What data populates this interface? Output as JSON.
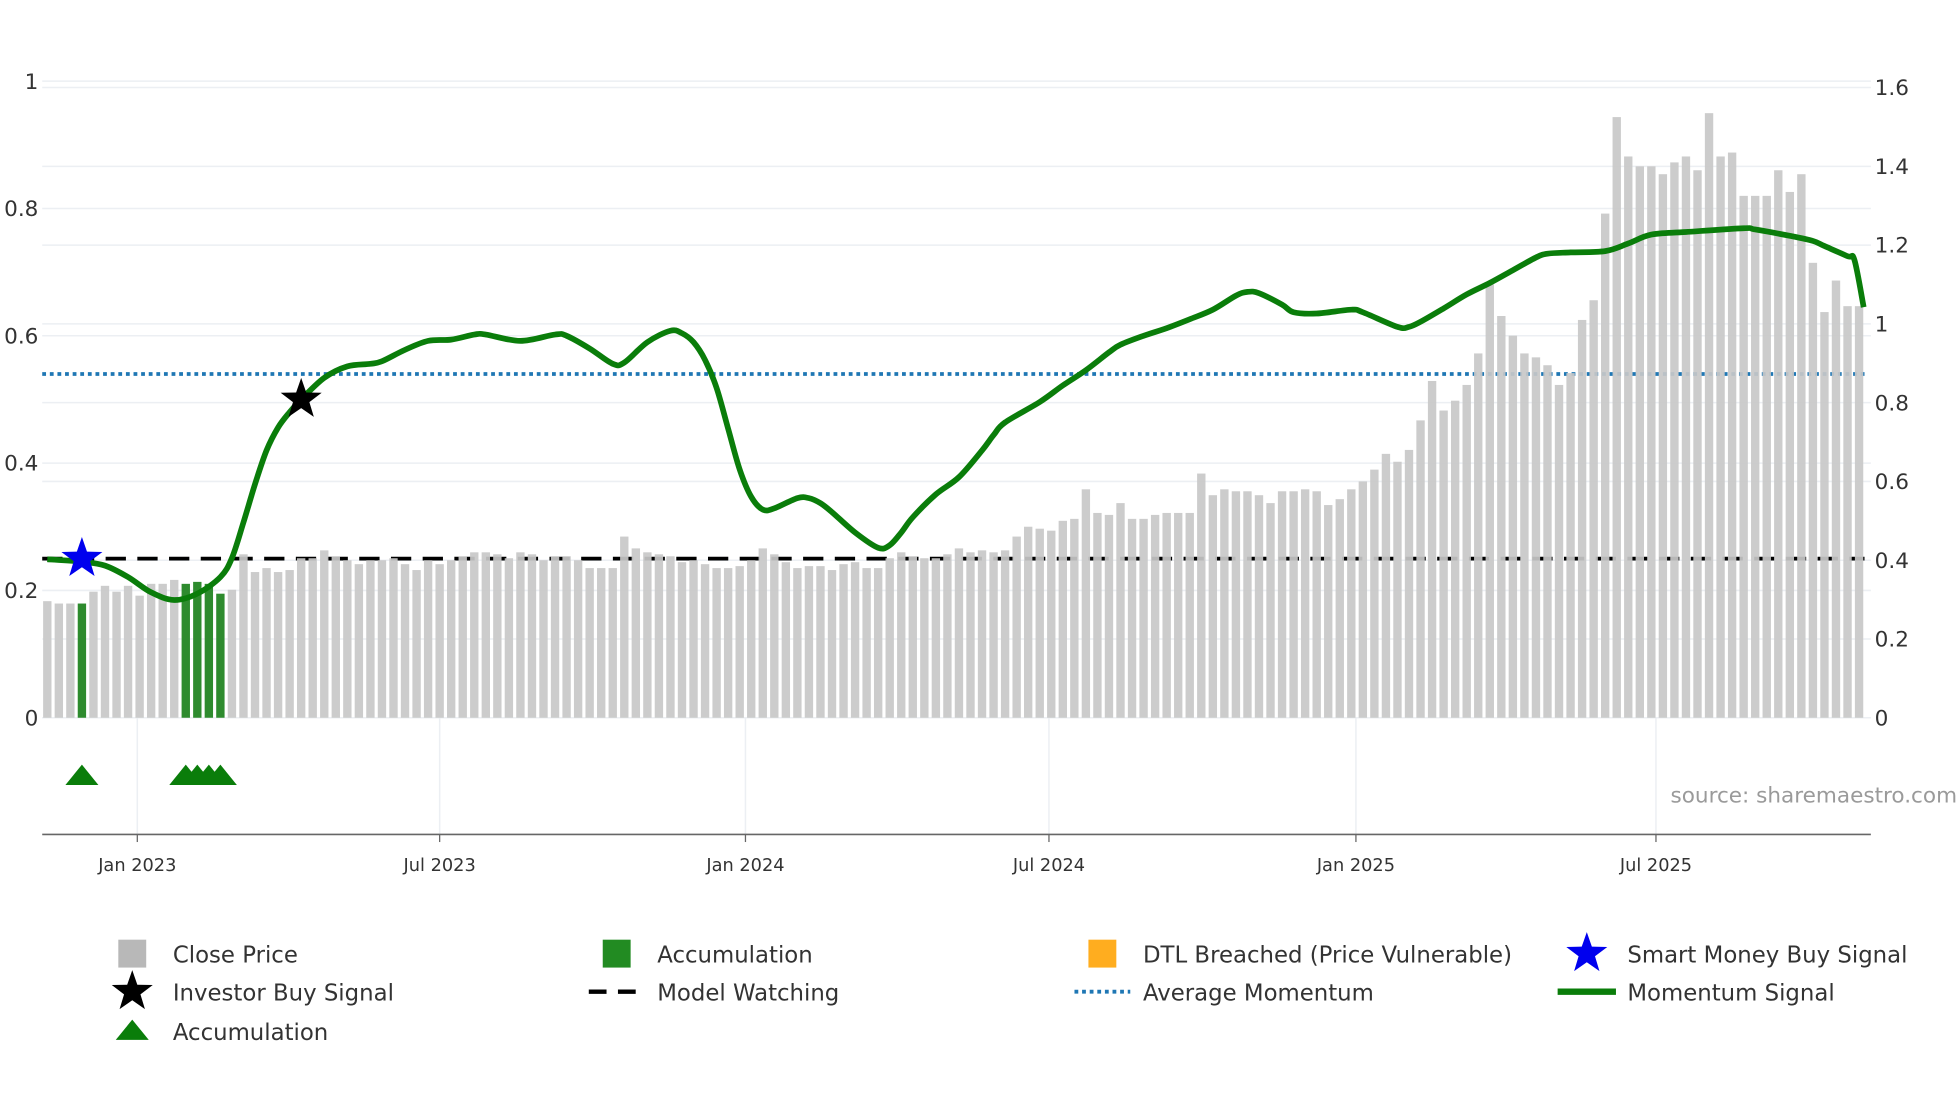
{
  "chart_data": {
    "type": "bar",
    "title": "",
    "source_label": "source: sharemaestro.com",
    "x_unit": "week index",
    "x_ticks": [
      {
        "label": "Jan 2023",
        "x": 7.8
      },
      {
        "label": "Jul 2023",
        "x": 34.0
      },
      {
        "label": "Jan 2024",
        "x": 60.5
      },
      {
        "label": "Jul 2024",
        "x": 86.8
      },
      {
        "label": "Jan 2025",
        "x": 113.4
      },
      {
        "label": "Jul 2025",
        "x": 139.4
      }
    ],
    "y_left": {
      "ticks": [
        "0",
        "0.2",
        "0.4",
        "0.6",
        "0.8",
        "1"
      ],
      "tick_values": [
        0,
        0.2,
        0.4,
        0.6,
        0.8,
        1
      ],
      "range": [
        -0.183,
        1.04
      ]
    },
    "y_right": {
      "ticks": [
        "0",
        "0.2",
        "0.4",
        "0.6",
        "0.8",
        "1",
        "1.2",
        "1.4",
        "1.6"
      ],
      "tick_values": [
        0,
        0.2,
        0.4,
        0.6,
        0.8,
        1,
        1.2,
        1.4,
        1.6
      ]
    },
    "close_price": [
      0.296,
      0.29,
      0.29,
      0.29,
      0.32,
      0.335,
      0.32,
      0.335,
      0.31,
      0.34,
      0.34,
      0.35,
      0.34,
      0.345,
      0.34,
      0.315,
      0.325,
      0.415,
      0.37,
      0.38,
      0.37,
      0.375,
      0.405,
      0.405,
      0.425,
      0.41,
      0.4,
      0.39,
      0.4,
      0.4,
      0.405,
      0.39,
      0.375,
      0.4,
      0.39,
      0.4,
      0.41,
      0.42,
      0.42,
      0.415,
      0.405,
      0.42,
      0.415,
      0.4,
      0.41,
      0.41,
      0.4,
      0.38,
      0.38,
      0.38,
      0.46,
      0.43,
      0.42,
      0.415,
      0.41,
      0.395,
      0.4,
      0.39,
      0.38,
      0.38,
      0.385,
      0.4,
      0.43,
      0.415,
      0.395,
      0.38,
      0.385,
      0.385,
      0.375,
      0.39,
      0.395,
      0.38,
      0.38,
      0.405,
      0.42,
      0.41,
      0.405,
      0.405,
      0.415,
      0.43,
      0.42,
      0.425,
      0.42,
      0.425,
      0.46,
      0.485,
      0.48,
      0.475,
      0.5,
      0.505,
      0.58,
      0.52,
      0.515,
      0.545,
      0.505,
      0.505,
      0.515,
      0.52,
      0.52,
      0.52,
      0.62,
      0.565,
      0.58,
      0.575,
      0.575,
      0.565,
      0.545,
      0.575,
      0.575,
      0.58,
      0.575,
      0.54,
      0.555,
      0.58,
      0.6,
      0.63,
      0.67,
      0.65,
      0.68,
      0.755,
      0.855,
      0.78,
      0.805,
      0.845,
      0.925,
      1.1,
      1.02,
      0.97,
      0.925,
      0.915,
      0.895,
      0.845,
      0.875,
      1.01,
      1.06,
      1.28,
      1.525,
      1.425,
      1.4,
      1.4,
      1.38,
      1.41,
      1.425,
      1.39,
      1.535,
      1.425,
      1.435,
      1.325,
      1.325,
      1.325,
      1.39,
      1.335,
      1.38,
      1.155,
      1.03,
      1.11,
      1.045,
      1.045
    ],
    "accumulation_weeks": [
      3,
      12,
      13,
      14,
      15
    ],
    "momentum_signal": [
      [
        0,
        0.249
      ],
      [
        3,
        0.245
      ],
      [
        5,
        0.239
      ],
      [
        7,
        0.221
      ],
      [
        9,
        0.197
      ],
      [
        11,
        0.185
      ],
      [
        13,
        0.195
      ],
      [
        15,
        0.221
      ],
      [
        16,
        0.251
      ],
      [
        17,
        0.307
      ],
      [
        18,
        0.367
      ],
      [
        19,
        0.42
      ],
      [
        20,
        0.456
      ],
      [
        21,
        0.48
      ],
      [
        22,
        0.5
      ],
      [
        24,
        0.534
      ],
      [
        26,
        0.552
      ],
      [
        28,
        0.556
      ],
      [
        29,
        0.56
      ],
      [
        31,
        0.578
      ],
      [
        33,
        0.592
      ],
      [
        35,
        0.594
      ],
      [
        37,
        0.602
      ],
      [
        38,
        0.602
      ],
      [
        41,
        0.592
      ],
      [
        44,
        0.602
      ],
      [
        45,
        0.6
      ],
      [
        47,
        0.58
      ],
      [
        49,
        0.556
      ],
      [
        50,
        0.558
      ],
      [
        52,
        0.59
      ],
      [
        54,
        0.608
      ],
      [
        55,
        0.604
      ],
      [
        56,
        0.59
      ],
      [
        57,
        0.562
      ],
      [
        58,
        0.518
      ],
      [
        59,
        0.454
      ],
      [
        60,
        0.39
      ],
      [
        61,
        0.347
      ],
      [
        62,
        0.327
      ],
      [
        63,
        0.329
      ],
      [
        65,
        0.345
      ],
      [
        66,
        0.345
      ],
      [
        67,
        0.337
      ],
      [
        68,
        0.323
      ],
      [
        70,
        0.291
      ],
      [
        72,
        0.267
      ],
      [
        73,
        0.271
      ],
      [
        74,
        0.291
      ],
      [
        75,
        0.315
      ],
      [
        77,
        0.351
      ],
      [
        79,
        0.378
      ],
      [
        81,
        0.42
      ],
      [
        82,
        0.444
      ],
      [
        83,
        0.464
      ],
      [
        86,
        0.496
      ],
      [
        88,
        0.522
      ],
      [
        90,
        0.546
      ],
      [
        92,
        0.574
      ],
      [
        93,
        0.586
      ],
      [
        95,
        0.6
      ],
      [
        97,
        0.612
      ],
      [
        99,
        0.626
      ],
      [
        101,
        0.641
      ],
      [
        103,
        0.663
      ],
      [
        104,
        0.669
      ],
      [
        105,
        0.667
      ],
      [
        107,
        0.649
      ],
      [
        108,
        0.637
      ],
      [
        110,
        0.635
      ],
      [
        113,
        0.641
      ],
      [
        114,
        0.637
      ],
      [
        117,
        0.614
      ],
      [
        118,
        0.614
      ],
      [
        119,
        0.622
      ],
      [
        121,
        0.643
      ],
      [
        123,
        0.665
      ],
      [
        125,
        0.683
      ],
      [
        127,
        0.703
      ],
      [
        129,
        0.723
      ],
      [
        130,
        0.729
      ],
      [
        132,
        0.731
      ],
      [
        135,
        0.733
      ],
      [
        137,
        0.745
      ],
      [
        139,
        0.759
      ],
      [
        142,
        0.763
      ],
      [
        147,
        0.769
      ],
      [
        148,
        0.767
      ],
      [
        151,
        0.757
      ],
      [
        153,
        0.749
      ],
      [
        154,
        0.741
      ],
      [
        156,
        0.725
      ],
      [
        156.6,
        0.719
      ],
      [
        157.4,
        0.645
      ]
    ],
    "average_momentum": 0.54,
    "model_watching": 0.25,
    "smart_money_buy_signals": [
      [
        3,
        0.25
      ]
    ],
    "investor_buy_signals": [
      [
        22,
        0.5
      ]
    ],
    "accumulation_markers": [
      3,
      12,
      13,
      14,
      15
    ],
    "legend": [
      {
        "label": "Close Price",
        "symbol": "square",
        "color": "#b8b8b8"
      },
      {
        "label": "Accumulation",
        "symbol": "square",
        "color": "#228b22"
      },
      {
        "label": "DTL Breached (Price Vulnerable)",
        "symbol": "square",
        "color": "#ffad1f"
      },
      {
        "label": "Smart Money Buy Signal",
        "symbol": "star",
        "color": "#0000ee"
      },
      {
        "label": "Investor Buy Signal",
        "symbol": "star",
        "color": "#000000"
      },
      {
        "label": "Model Watching",
        "symbol": "dash",
        "color": "#000000"
      },
      {
        "label": "Average Momentum",
        "symbol": "dot",
        "color": "#1f77b4"
      },
      {
        "label": "Momentum Signal",
        "symbol": "line",
        "color": "#0a7d0a"
      },
      {
        "label": "Accumulation",
        "symbol": "triangle",
        "color": "#0a7d0a"
      }
    ],
    "legend_placement": "bottom",
    "colors": {
      "bar": "#c8c8c8",
      "accumulation_bar": "#2e8b2e",
      "momentum": "#0a7d0a",
      "avg": "#1f77b4",
      "watch": "#000000",
      "grid": "#eceff3"
    }
  }
}
